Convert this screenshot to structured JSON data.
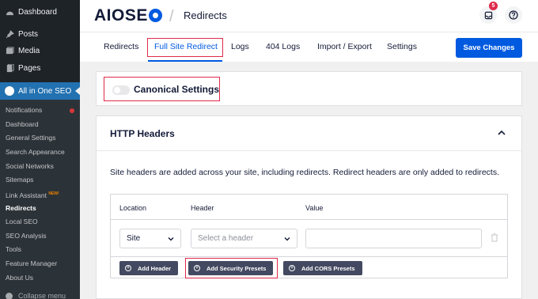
{
  "sidebar": {
    "top_items": [
      {
        "label": "Dashboard",
        "icon": "dashboard-icon"
      },
      {
        "label": "Posts",
        "icon": "pin-icon"
      },
      {
        "label": "Media",
        "icon": "media-icon"
      },
      {
        "label": "Pages",
        "icon": "pages-icon"
      }
    ],
    "active_item": {
      "label": "All in One SEO",
      "icon": "aioseo-icon"
    },
    "submenu": [
      {
        "label": "Notifications"
      },
      {
        "label": "Dashboard"
      },
      {
        "label": "General Settings"
      },
      {
        "label": "Search Appearance"
      },
      {
        "label": "Social Networks"
      },
      {
        "label": "Sitemaps"
      },
      {
        "label": "Link Assistant",
        "badge": "NEW!"
      },
      {
        "label": "Redirects"
      },
      {
        "label": "Local SEO"
      },
      {
        "label": "SEO Analysis"
      },
      {
        "label": "Tools"
      },
      {
        "label": "Feature Manager"
      },
      {
        "label": "About Us"
      }
    ],
    "collapse_label": "Collapse menu"
  },
  "header": {
    "logo_text": "AIOSEO",
    "divider": "/",
    "title": "Redirects",
    "inbox_count": "5"
  },
  "tabs": {
    "items": [
      "Redirects",
      "Full Site Redirect",
      "Logs",
      "404 Logs",
      "Import / Export",
      "Settings"
    ],
    "save_label": "Save Changes"
  },
  "canonical": {
    "label": "Canonical Settings"
  },
  "http_headers": {
    "title": "HTTP Headers",
    "description": "Site headers are added across your site, including redirects. Redirect headers are only added to redirects.",
    "columns": [
      "Location",
      "Header",
      "Value"
    ],
    "row": {
      "location": "Site",
      "header_placeholder": "Select a header",
      "value": ""
    },
    "buttons": [
      "Add Header",
      "Add Security Presets",
      "Add CORS Presets"
    ]
  },
  "colors": {
    "brand_blue": "#005ae0",
    "highlight_red": "#df2a4a",
    "wp_sidebar": "#1d2327",
    "wp_active": "#2271b1"
  }
}
